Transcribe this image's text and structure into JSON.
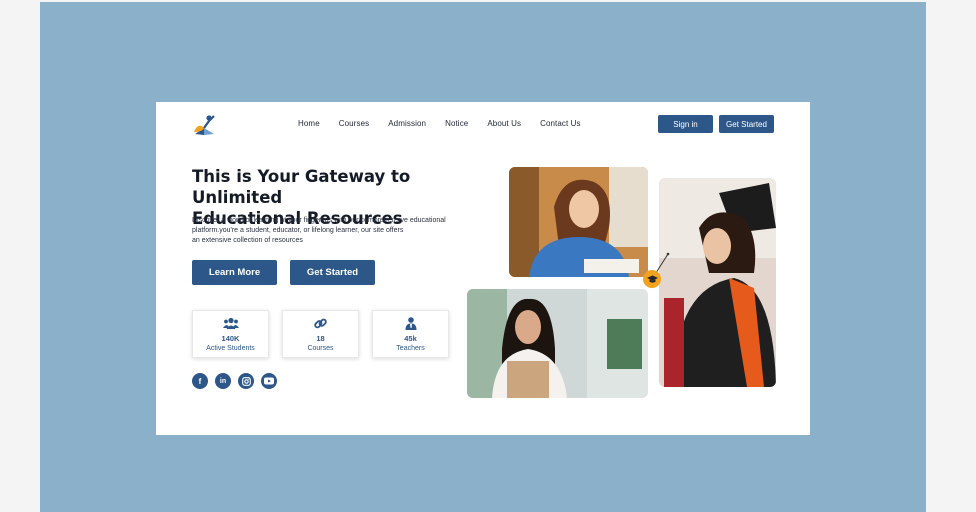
{
  "nav": {
    "items": [
      "Home",
      "Courses",
      "Admission",
      "Notice",
      "About Us",
      "Contact Us"
    ],
    "sign_in": "Sign in",
    "get_started": "Get Started"
  },
  "hero": {
    "title_line1": "This is Your Gateway to Unlimited",
    "title_line2": "Educational Resources",
    "desc_line1": "Discover a world of learning at your fingertips with our comprehensive educational",
    "desc_line2": "platform.you're a student, educator, or lifelong learner, our site offers",
    "desc_line3": "an extensive collection of resources",
    "learn_more": "Learn More",
    "get_started": "Get Started"
  },
  "stats": [
    {
      "icon": "users-icon",
      "value": "140K",
      "label": "Active Students"
    },
    {
      "icon": "link-icon",
      "value": "18",
      "label": "Courses"
    },
    {
      "icon": "teacher-icon",
      "value": "45k",
      "label": "Teachers"
    }
  ],
  "social": [
    "facebook-icon",
    "linkedin-icon",
    "instagram-icon",
    "youtube-icon"
  ],
  "colors": {
    "accent": "#2c5788",
    "background": "#8bb0c9",
    "badge": "#f2a21c"
  }
}
